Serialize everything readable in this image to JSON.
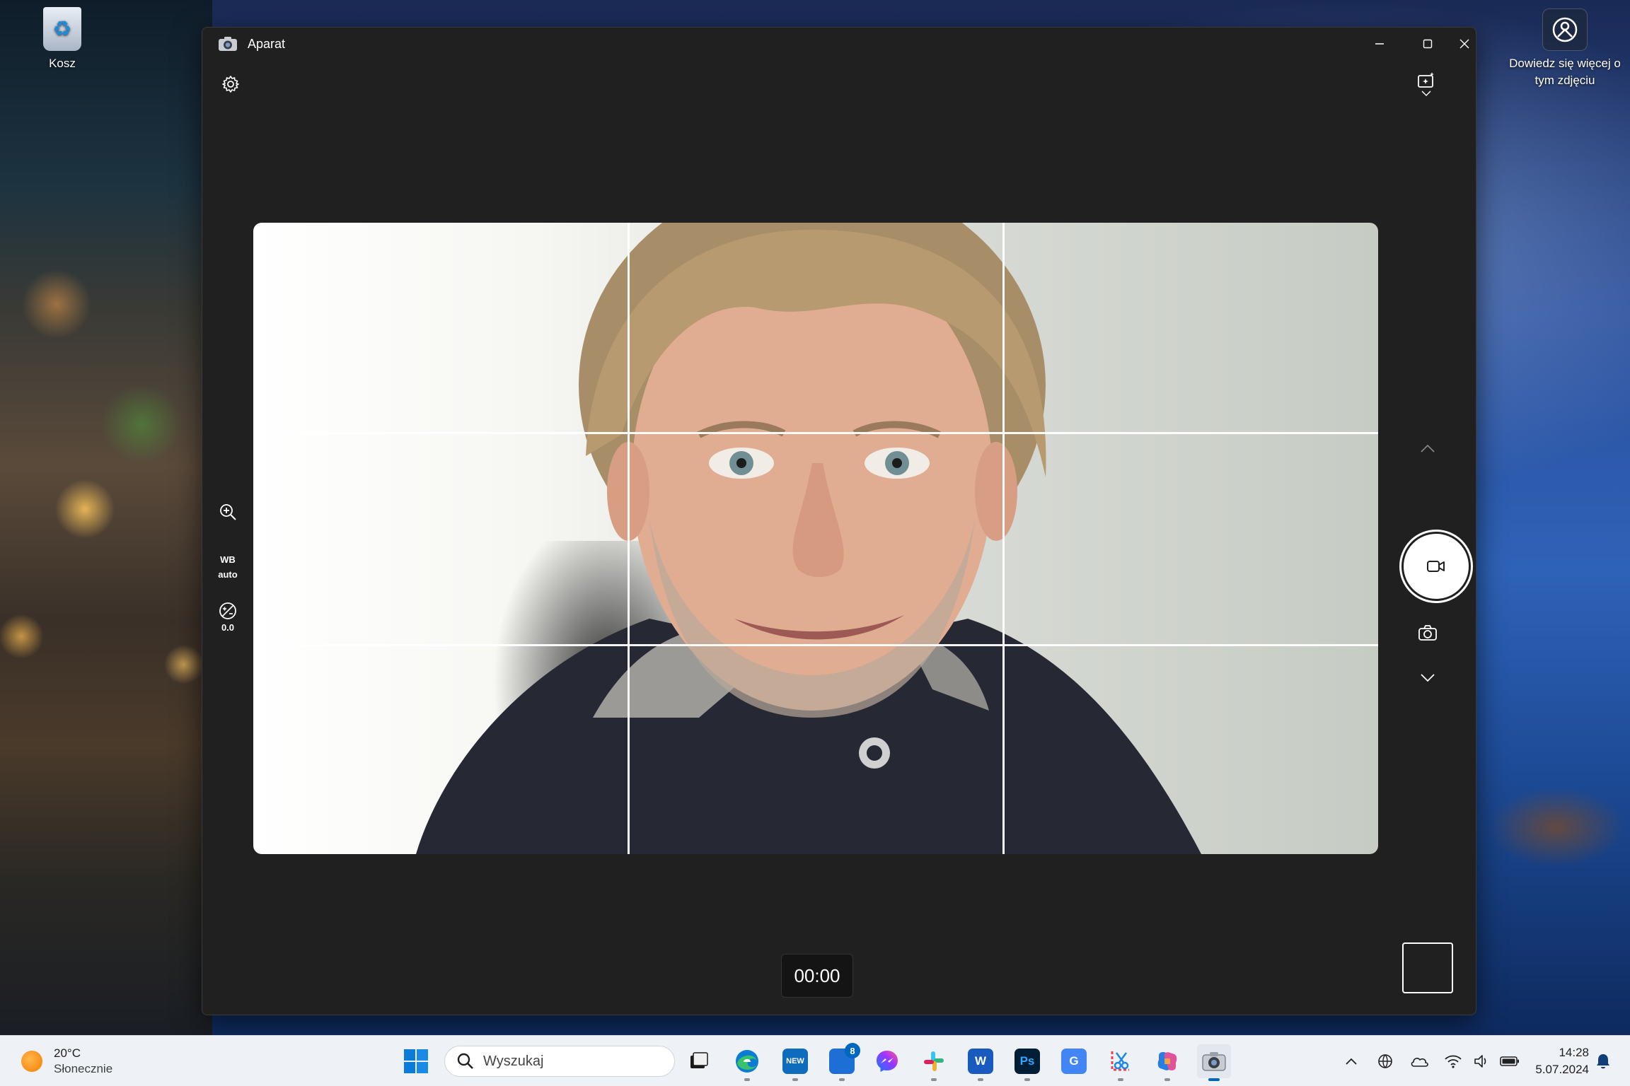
{
  "desktop": {
    "recycle_bin_label": "Kosz",
    "spotlight_label_line1": "Dowiedz się więcej o",
    "spotlight_label_line2": "tym zdjęciu"
  },
  "window": {
    "title": "Aparat",
    "timer": "00:00",
    "wb": {
      "label": "WB",
      "value": "auto"
    },
    "exposure_value": "0.0"
  },
  "taskbar": {
    "weather": {
      "temp": "20°C",
      "condition": "Słonecznie"
    },
    "search_placeholder": "Wyszukaj",
    "apps": [
      {
        "name": "task-view",
        "label": ""
      },
      {
        "name": "edge",
        "label": ""
      },
      {
        "name": "outlook-new",
        "label": "NEW"
      },
      {
        "name": "store",
        "label": "",
        "badge": "8"
      },
      {
        "name": "messenger",
        "label": ""
      },
      {
        "name": "slack",
        "label": ""
      },
      {
        "name": "word",
        "label": "W"
      },
      {
        "name": "photoshop",
        "label": "Ps"
      },
      {
        "name": "translate",
        "label": "G"
      },
      {
        "name": "snipping-tool",
        "label": ""
      },
      {
        "name": "copilot",
        "label": ""
      },
      {
        "name": "camera",
        "label": ""
      }
    ],
    "clock_time": "14:28",
    "clock_date": "5.07.2024"
  },
  "colors": {
    "window_bg": "#202020",
    "accent": "#0067c0",
    "taskbar_bg": "#eef1f6"
  }
}
